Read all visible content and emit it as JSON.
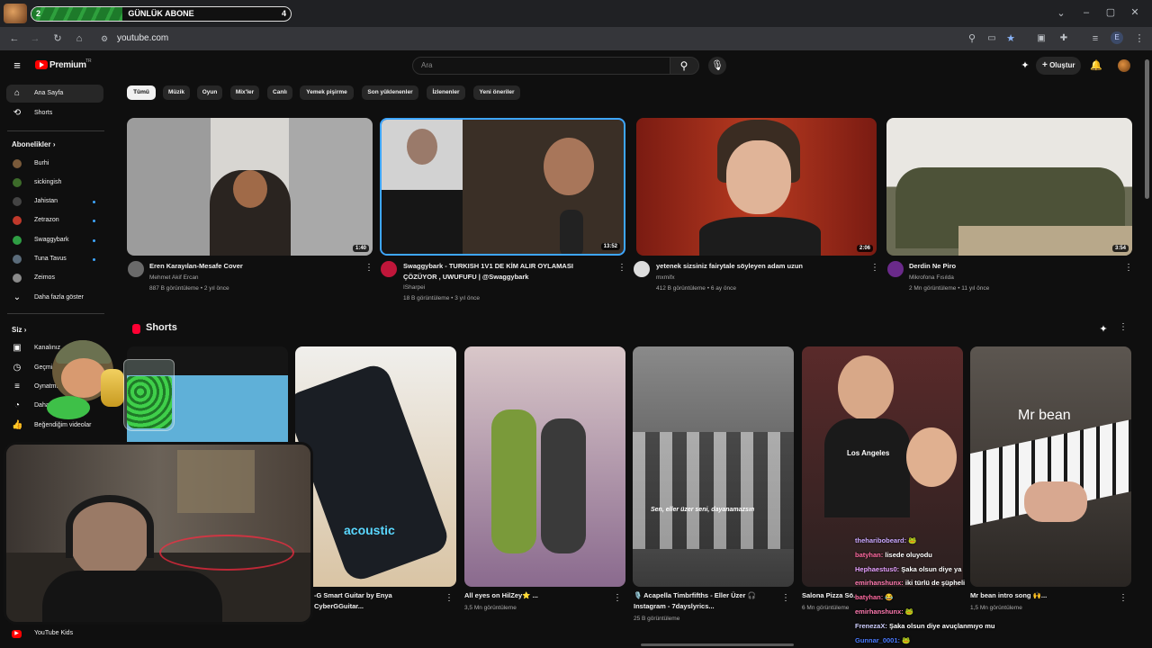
{
  "overlay": {
    "label": "GÜNLÜK ABONE",
    "left_number": "2",
    "right_number": "4",
    "progress": 0.35
  },
  "browser": {
    "url": "youtube.com",
    "profile_initial": "E"
  },
  "masthead": {
    "logo_text": "Premium",
    "logo_region": "TR",
    "search_placeholder": "Ara",
    "create_label": "Oluştur"
  },
  "sidebar": {
    "main": [
      {
        "label": "Ana Sayfa",
        "icon": "home-icon",
        "active": true
      },
      {
        "label": "Shorts",
        "icon": "shorts-icon",
        "active": false
      }
    ],
    "subscriptions_heading": "Abonelikler",
    "subscriptions": [
      {
        "label": "Burhi",
        "live": false,
        "color": "#7a5a3a"
      },
      {
        "label": "sickingish",
        "live": false,
        "color": "#3d6b2a"
      },
      {
        "label": "Jahistan",
        "live": true,
        "color": "#444444"
      },
      {
        "label": "Zetrazon",
        "live": true,
        "color": "#c0392b"
      },
      {
        "label": "Swaggybark",
        "live": true,
        "color": "#2f9e44"
      },
      {
        "label": "Tuna Tavus",
        "live": true,
        "color": "#5a6b7a"
      },
      {
        "label": "Zeimos",
        "live": false,
        "color": "#8a8a8a"
      }
    ],
    "show_more": "Daha fazla göster",
    "you_heading": "Siz",
    "you_items": [
      {
        "label": "Kanalınız",
        "icon": "channel-icon"
      },
      {
        "label": "Geçmiş",
        "icon": "history-icon"
      },
      {
        "label": "Oynatma listeleri",
        "icon": "playlists-icon"
      },
      {
        "label": "Daha sonra izle",
        "icon": "watch-later-icon"
      },
      {
        "label": "Beğendiğim videolar",
        "icon": "like-icon"
      }
    ],
    "kids_label": "YouTube Kids"
  },
  "chips": [
    "Tümü",
    "Müzik",
    "Oyun",
    "Mix'ler",
    "Canlı",
    "Yemek pişirme",
    "Son yüklenenler",
    "İzlenenler",
    "Yeni öneriler"
  ],
  "videos": [
    {
      "title": "Eren Karayılan-Mesafe Cover",
      "title2": "",
      "channel": "Mehmet Akif Ercan",
      "stats": "887 B görüntüleme • 2 yıl önce",
      "duration": "1:40"
    },
    {
      "title": "Swaggybark -  TURKISH 1V1 DE KİM ALIR OYLAMASI",
      "title2": "ÇÖZÜYOR , UWUFUFU | @Swaggybark",
      "channel": "ISharpei",
      "stats": "18 B görüntüleme • 3 yıl önce",
      "duration": "13:52"
    },
    {
      "title": "yetenek sizsiniz fairytale söyleyen adam uzun",
      "title2": "",
      "channel": "mxmifx",
      "stats": "412 B görüntüleme • 6 ay önce",
      "duration": "2:06"
    },
    {
      "title": "Derdin Ne Piro",
      "title2": "",
      "channel": "Mikrofona Fısılda",
      "stats": "2 Mn görüntüleme • 11 yıl önce",
      "duration": "3:54"
    }
  ],
  "shorts_heading": "Shorts",
  "shorts": [
    {
      "title": "",
      "views": "",
      "caption": ""
    },
    {
      "title": "-G Smart Guitar by Enya",
      "title2": "CyberGGuitar...",
      "views": "",
      "caption": "acoustic"
    },
    {
      "title": "All eyes on HilZey⭐ ...",
      "views": "3,5 Mn görüntüleme",
      "caption": ""
    },
    {
      "title": "🎙️ Acapella Timbrfifths - Eller Üzer 🎧",
      "title2": "Instagram - 7dayslyrics...",
      "views": "25 B görüntüleme",
      "caption": "Sen, eller üzer seni, dayanamazsın"
    },
    {
      "title": "Salona Pizza Sö...",
      "views": "6 Mn görüntüleme",
      "caption": "Los Angeles"
    },
    {
      "title": "Mr bean intro song 🙌...",
      "views": "1,5 Mn görüntüleme",
      "caption": "Mr bean"
    }
  ],
  "chat": [
    {
      "user": "theharibobeard:",
      "msg": "🐸"
    },
    {
      "user": "batyhan:",
      "msg": "lisede oluyodu"
    },
    {
      "user": "Hephaestus0:",
      "msg": "Şaka olsun diye ya"
    },
    {
      "user": "emirhanshunx:",
      "msg": "iki türlü de şüpheli"
    },
    {
      "user": "batyhan:",
      "msg": "😂"
    },
    {
      "user": "emirhanshunx:",
      "msg": "🐸"
    },
    {
      "user": "FrenezaX:",
      "msg": "Şaka olsun diye avuçlanmıyo mu"
    },
    {
      "user": "Gunnar_0001:",
      "msg": "🐸"
    }
  ]
}
